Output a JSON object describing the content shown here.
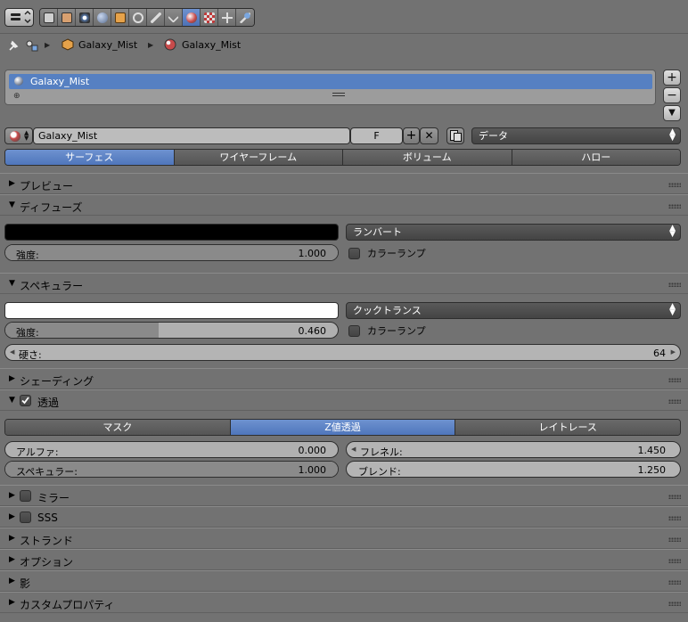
{
  "breadcrumb": {
    "object": "Galaxy_Mist",
    "material": "Galaxy_Mist"
  },
  "material_slots": {
    "items": [
      "Galaxy_Mist"
    ],
    "add_label": "+",
    "remove_label": "−",
    "menu_label": "▼"
  },
  "id_block": {
    "name": "Galaxy_Mist",
    "fake_user": "F",
    "link_type": "データ"
  },
  "type_tabs": [
    "サーフェス",
    "ワイヤーフレーム",
    "ボリューム",
    "ハロー"
  ],
  "active_type_tab": 0,
  "panels": {
    "preview": "プレビュー",
    "diffuse": "ディフューズ",
    "specular": "スペキュラー",
    "shading": "シェーディング",
    "transparency": "透過",
    "mirror": "ミラー",
    "sss": "SSS",
    "strand": "ストランド",
    "options": "オプション",
    "shadow": "影",
    "custom_properties": "カスタムプロパティ"
  },
  "diffuse": {
    "color": "#000000",
    "shader": "ランバート",
    "intensity_label": "強度:",
    "intensity": "1.000",
    "intensity_fraction": 1.0,
    "ramp_label": "カラーランプ"
  },
  "specular": {
    "color": "#ffffff",
    "shader": "クックトランス",
    "intensity_label": "強度:",
    "intensity": "0.460",
    "intensity_fraction": 0.46,
    "ramp_label": "カラーランプ",
    "hardness_label": "硬さ:",
    "hardness": "64"
  },
  "transparency": {
    "modes": [
      "マスク",
      "Z値透過",
      "レイトレース"
    ],
    "active_mode": 1,
    "alpha_label": "アルファ:",
    "alpha": "0.000",
    "alpha_fraction": 0.0,
    "specular_label": "スペキュラー:",
    "specular": "1.000",
    "specular_fraction": 1.0,
    "fresnel_label": "フレネル:",
    "fresnel": "1.450",
    "blend_label": "ブレンド:",
    "blend": "1.250"
  },
  "colors": {
    "accent": "#5680c2",
    "background": "#727272"
  }
}
